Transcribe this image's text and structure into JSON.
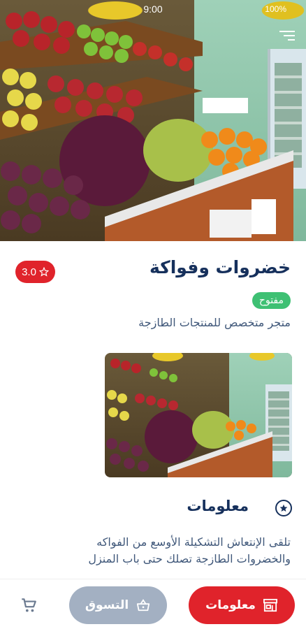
{
  "status_bar": {
    "time": "9:00",
    "battery": "100%"
  },
  "store": {
    "name": "خضروات وفواكة",
    "status": "مفتوح",
    "tagline": "متجر متخصص للمنتجات الطازجة",
    "rating": "3.0"
  },
  "info_section": {
    "title": "معلومات",
    "description": "تلقى الإنتعاش التشكيلة الأوسع من الفواكه والخضروات الطازجة تصلك حتى باب المنزل"
  },
  "bottom_nav": {
    "info_label": "معلومات",
    "shop_label": "التسوق"
  },
  "colors": {
    "primary_red": "#e0232b",
    "navy": "#16305c",
    "open_green": "#3ec073",
    "disabled_gray": "#a3b0c2"
  },
  "icons": {
    "menu": "menu-icon",
    "star": "star-icon",
    "info_section": "badge-icon",
    "store": "store-icon",
    "basket": "basket-icon",
    "cart": "cart-icon"
  }
}
